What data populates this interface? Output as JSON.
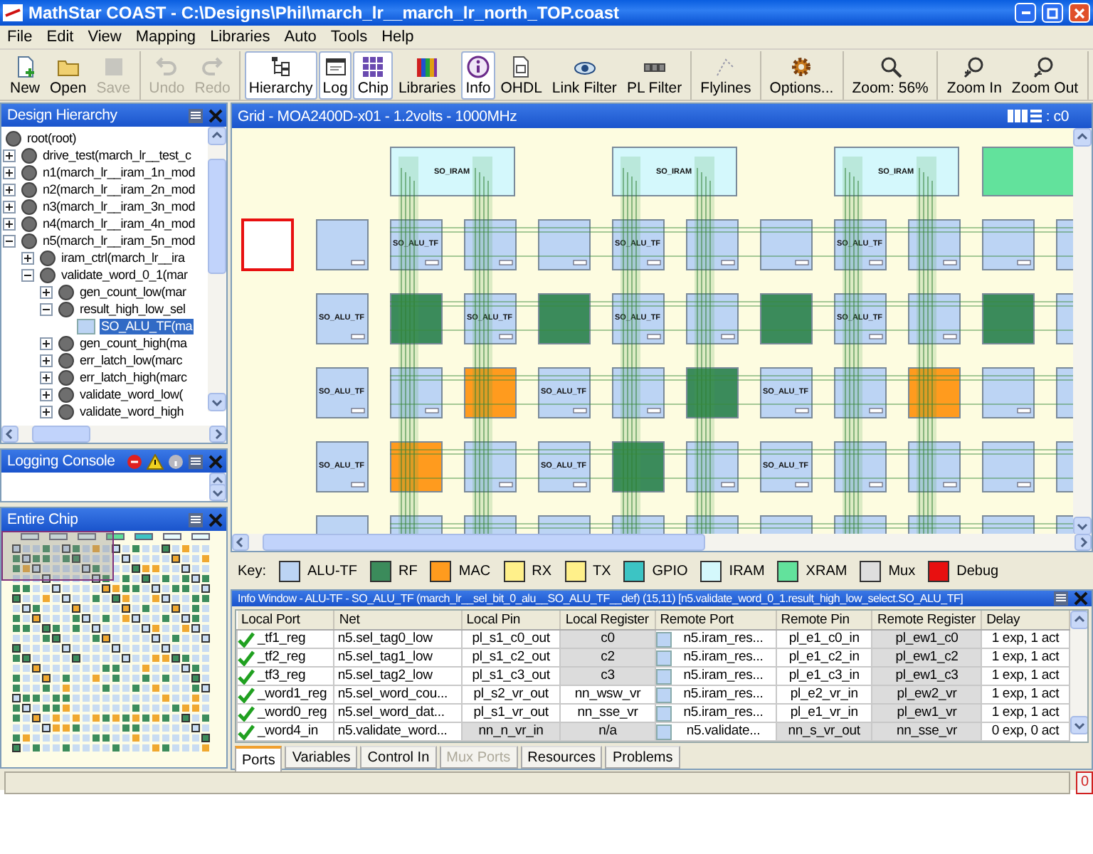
{
  "window": {
    "title": "MathStar COAST - C:\\Designs\\Phil\\march_lr__march_lr_north_TOP.coast"
  },
  "menu": [
    "File",
    "Edit",
    "View",
    "Mapping",
    "Libraries",
    "Auto",
    "Tools",
    "Help"
  ],
  "toolbar": [
    [
      {
        "label": "New",
        "disabled": false,
        "pressed": false
      },
      {
        "label": "Open",
        "disabled": false,
        "pressed": false
      },
      {
        "label": "Save",
        "disabled": true,
        "pressed": false
      }
    ],
    [
      {
        "label": "Undo",
        "disabled": true,
        "pressed": false
      },
      {
        "label": "Redo",
        "disabled": true,
        "pressed": false
      }
    ],
    [
      {
        "label": "Hierarchy",
        "disabled": false,
        "pressed": true
      },
      {
        "label": "Log",
        "disabled": false,
        "pressed": true
      },
      {
        "label": "Chip",
        "disabled": false,
        "pressed": true
      },
      {
        "label": "Libraries",
        "disabled": false,
        "pressed": false
      },
      {
        "label": "Info",
        "disabled": false,
        "pressed": true
      },
      {
        "label": "OHDL",
        "disabled": false,
        "pressed": false
      },
      {
        "label": "Link Filter",
        "disabled": false,
        "pressed": false
      },
      {
        "label": "PL Filter",
        "disabled": false,
        "pressed": false
      }
    ],
    [
      {
        "label": "Flylines",
        "disabled": false,
        "pressed": false
      }
    ],
    [
      {
        "label": "Options...",
        "disabled": false,
        "pressed": false
      }
    ],
    [
      {
        "label": "Zoom: 56%",
        "disabled": false,
        "pressed": false
      }
    ],
    [
      {
        "label": "Zoom In",
        "disabled": false,
        "pressed": false
      },
      {
        "label": "Zoom Out",
        "disabled": false,
        "pressed": false
      }
    ]
  ],
  "hierarchy": {
    "title": "Design Hierarchy",
    "tree": {
      "label": "root(root)",
      "kind": "module",
      "selected": false,
      "children": [
        {
          "label": "drive_test(march_lr__test_c",
          "kind": "module",
          "expanded": false,
          "selected": false
        },
        {
          "label": "n1(march_lr__iram_1n_mod",
          "kind": "module",
          "expanded": false,
          "selected": false
        },
        {
          "label": "n2(march_lr__iram_2n_mod",
          "kind": "module",
          "expanded": false,
          "selected": false
        },
        {
          "label": "n3(march_lr__iram_3n_mod",
          "kind": "module",
          "expanded": false,
          "selected": false
        },
        {
          "label": "n4(march_lr__iram_4n_mod",
          "kind": "module",
          "expanded": false,
          "selected": false
        },
        {
          "label": "n5(march_lr__iram_5n_mod",
          "kind": "module",
          "expanded": true,
          "selected": false,
          "children": [
            {
              "label": "iram_ctrl(march_lr__ira",
              "kind": "module",
              "expanded": false,
              "selected": false
            },
            {
              "label": "validate_word_0_1(mar",
              "kind": "module",
              "expanded": true,
              "selected": false,
              "children": [
                {
                  "label": "gen_count_low(mar",
                  "kind": "module",
                  "expanded": false,
                  "selected": false
                },
                {
                  "label": "result_high_low_sel",
                  "kind": "module",
                  "expanded": true,
                  "selected": false,
                  "children": [
                    {
                      "label": "SO_ALU_TF(ma",
                      "kind": "tile",
                      "selected": true
                    }
                  ]
                },
                {
                  "label": "gen_count_high(ma",
                  "kind": "module",
                  "expanded": false,
                  "selected": false
                },
                {
                  "label": "err_latch_low(marc",
                  "kind": "module",
                  "expanded": false,
                  "selected": false
                },
                {
                  "label": "err_latch_high(marc",
                  "kind": "module",
                  "expanded": false,
                  "selected": false
                },
                {
                  "label": "validate_word_low(",
                  "kind": "module",
                  "expanded": false,
                  "selected": false
                },
                {
                  "label": "validate_word_high",
                  "kind": "module",
                  "expanded": false,
                  "selected": false
                }
              ]
            }
          ]
        }
      ]
    }
  },
  "logging_console": {
    "title": "Logging Console"
  },
  "entire_chip": {
    "title": "Entire Chip"
  },
  "grid": {
    "title": "Grid - MOA2400D-x01 - 1.2volts - 1000MHz",
    "context": ": c0",
    "top_tiles": [
      {
        "kind": "iram",
        "label": "SO_IRAM"
      },
      {
        "kind": "iram",
        "label": "SO_IRAM"
      },
      {
        "kind": "iram",
        "label": "SO_IRAM"
      },
      {
        "kind": "xram"
      }
    ],
    "debug_tile": {
      "kind": "debug"
    },
    "rows": [
      {
        "tiles": [
          {
            "kind": "alu"
          },
          {
            "kind": "alu",
            "label": "SO_ALU_TF"
          },
          {
            "kind": "alu"
          },
          {
            "kind": "alu"
          },
          {
            "kind": "alu",
            "label": "SO_ALU_TF"
          },
          {
            "kind": "alu"
          },
          {
            "kind": "alu"
          },
          {
            "kind": "alu",
            "label": "SO_ALU_TF"
          },
          {
            "kind": "alu"
          },
          {
            "kind": "alu"
          },
          {
            "kind": "alu"
          }
        ]
      },
      {
        "tiles": [
          {
            "kind": "alu",
            "label": "SO_ALU_TF"
          },
          {
            "kind": "rf"
          },
          {
            "kind": "alu",
            "label": "SO_ALU_TF"
          },
          {
            "kind": "rf"
          },
          {
            "kind": "alu",
            "label": "SO_ALU_TF"
          },
          {
            "kind": "alu"
          },
          {
            "kind": "rf"
          },
          {
            "kind": "alu",
            "label": "SO_ALU_TF"
          },
          {
            "kind": "alu"
          },
          {
            "kind": "rf"
          },
          {
            "kind": "alu"
          }
        ]
      },
      {
        "tiles": [
          {
            "kind": "alu",
            "label": "SO_ALU_TF"
          },
          {
            "kind": "alu"
          },
          {
            "kind": "mac"
          },
          {
            "kind": "alu",
            "label": "SO_ALU_TF"
          },
          {
            "kind": "alu"
          },
          {
            "kind": "rf"
          },
          {
            "kind": "alu",
            "label": "SO_ALU_TF"
          },
          {
            "kind": "alu"
          },
          {
            "kind": "mac"
          },
          {
            "kind": "alu"
          },
          {
            "kind": "alu"
          }
        ]
      },
      {
        "tiles": [
          {
            "kind": "alu",
            "label": "SO_ALU_TF"
          },
          {
            "kind": "mac"
          },
          {
            "kind": "alu"
          },
          {
            "kind": "alu",
            "label": "SO_ALU_TF"
          },
          {
            "kind": "rf"
          },
          {
            "kind": "alu"
          },
          {
            "kind": "alu",
            "label": "SO_ALU_TF"
          },
          {
            "kind": "alu"
          },
          {
            "kind": "alu"
          },
          {
            "kind": "alu"
          },
          {
            "kind": "alu"
          }
        ]
      },
      {
        "tiles": [
          {
            "kind": "alu"
          },
          {
            "kind": "alu"
          },
          {
            "kind": "alu"
          },
          {
            "kind": "alu"
          },
          {
            "kind": "alu"
          },
          {
            "kind": "alu"
          },
          {
            "kind": "alu"
          },
          {
            "kind": "alu"
          },
          {
            "kind": "alu"
          },
          {
            "kind": "alu"
          },
          {
            "kind": "alu"
          }
        ]
      }
    ]
  },
  "key": {
    "label": "Key:",
    "items": [
      {
        "kind": "alu",
        "label": "ALU-TF",
        "color": "#bcd4f4"
      },
      {
        "kind": "rf",
        "label": "RF",
        "color": "#3b8b5b"
      },
      {
        "kind": "mac",
        "label": "MAC",
        "color": "#ff9b1e"
      },
      {
        "kind": "rx",
        "label": "RX",
        "color": "#fff08a"
      },
      {
        "kind": "tx",
        "label": "TX",
        "color": "#fff08a"
      },
      {
        "kind": "gpio",
        "label": "GPIO",
        "color": "#3cc4c4"
      },
      {
        "kind": "iram",
        "label": "IRAM",
        "color": "#d4f8fc"
      },
      {
        "kind": "xram",
        "label": "XRAM",
        "color": "#62e29c"
      },
      {
        "kind": "mux",
        "label": "Mux",
        "color": "#dedede"
      },
      {
        "kind": "debug",
        "label": "Debug",
        "color": "#e81010"
      }
    ]
  },
  "info_window": {
    "title": "Info Window - ALU-TF - SO_ALU_TF (march_lr__sel_bit_0_alu__SO_ALU_TF__def) (15,11) [n5.validate_word_0_1.result_high_low_select.SO_ALU_TF]",
    "columns": [
      "Local Port",
      "Net",
      "Local Pin",
      "Local Register",
      "Remote Port",
      "Remote Pin",
      "Remote Register",
      "Delay"
    ],
    "rows": [
      {
        "cells": [
          {
            "text": "_tf1_reg",
            "shaded": false
          },
          {
            "text": "n5.sel_tag0_low",
            "shaded": false
          },
          {
            "text": "pl_s1_c0_out",
            "shaded": false
          },
          {
            "text": "c0",
            "shaded": true
          },
          {
            "text": "n5.iram_res...",
            "shaded": false
          },
          {
            "text": "pl_e1_c0_in",
            "shaded": false
          },
          {
            "text": "pl_ew1_c0",
            "shaded": true
          },
          {
            "text": "1 exp, 1 act",
            "shaded": false
          }
        ]
      },
      {
        "cells": [
          {
            "text": "_tf2_reg",
            "shaded": false
          },
          {
            "text": "n5.sel_tag1_low",
            "shaded": false
          },
          {
            "text": "pl_s1_c2_out",
            "shaded": false
          },
          {
            "text": "c2",
            "shaded": true
          },
          {
            "text": "n5.iram_res...",
            "shaded": false
          },
          {
            "text": "pl_e1_c2_in",
            "shaded": false
          },
          {
            "text": "pl_ew1_c2",
            "shaded": true
          },
          {
            "text": "1 exp, 1 act",
            "shaded": false
          }
        ]
      },
      {
        "cells": [
          {
            "text": "_tf3_reg",
            "shaded": false
          },
          {
            "text": "n5.sel_tag2_low",
            "shaded": false
          },
          {
            "text": "pl_s1_c3_out",
            "shaded": false
          },
          {
            "text": "c3",
            "shaded": true
          },
          {
            "text": "n5.iram_res...",
            "shaded": false
          },
          {
            "text": "pl_e1_c3_in",
            "shaded": false
          },
          {
            "text": "pl_ew1_c3",
            "shaded": true
          },
          {
            "text": "1 exp, 1 act",
            "shaded": false
          }
        ]
      },
      {
        "cells": [
          {
            "text": "_word1_reg",
            "shaded": false
          },
          {
            "text": "n5.sel_word_cou...",
            "shaded": false
          },
          {
            "text": "pl_s2_vr_out",
            "shaded": false
          },
          {
            "text": "nn_wsw_vr",
            "shaded": false
          },
          {
            "text": "n5.iram_res...",
            "shaded": false
          },
          {
            "text": "pl_e2_vr_in",
            "shaded": false
          },
          {
            "text": "pl_ew2_vr",
            "shaded": true
          },
          {
            "text": "1 exp, 1 act",
            "shaded": false
          }
        ]
      },
      {
        "cells": [
          {
            "text": "_word0_reg",
            "shaded": false
          },
          {
            "text": "n5.sel_word_dat...",
            "shaded": false
          },
          {
            "text": "pl_s1_vr_out",
            "shaded": false
          },
          {
            "text": "nn_sse_vr",
            "shaded": false
          },
          {
            "text": "n5.iram_res...",
            "shaded": false
          },
          {
            "text": "pl_e1_vr_in",
            "shaded": false
          },
          {
            "text": "pl_ew1_vr",
            "shaded": true
          },
          {
            "text": "1 exp, 1 act",
            "shaded": false
          }
        ]
      },
      {
        "cells": [
          {
            "text": "_word4_in",
            "shaded": false
          },
          {
            "text": "n5.validate_word...",
            "shaded": false
          },
          {
            "text": "nn_n_vr_in",
            "shaded": true
          },
          {
            "text": "n/a",
            "shaded": true
          },
          {
            "text": "n5.validate...",
            "shaded": false
          },
          {
            "text": "nn_s_vr_out",
            "shaded": true
          },
          {
            "text": "nn_sse_vr",
            "shaded": true
          },
          {
            "text": "0 exp, 0 act",
            "shaded": false
          }
        ]
      }
    ],
    "tabs": [
      {
        "label": "Ports",
        "selected": true,
        "disabled": false
      },
      {
        "label": "Variables",
        "selected": false,
        "disabled": false
      },
      {
        "label": "Control In",
        "selected": false,
        "disabled": false
      },
      {
        "label": "Mux Ports",
        "selected": false,
        "disabled": true
      },
      {
        "label": "Resources",
        "selected": false,
        "disabled": false
      },
      {
        "label": "Problems",
        "selected": false,
        "disabled": false
      }
    ]
  },
  "status_bar": {
    "error_count": "0"
  }
}
